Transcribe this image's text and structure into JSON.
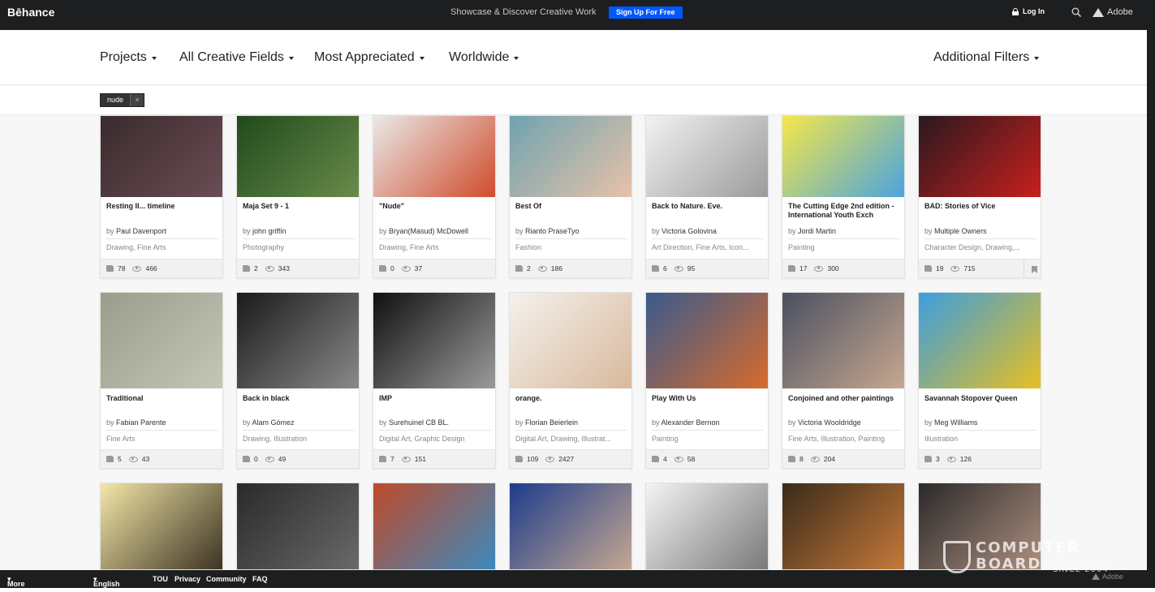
{
  "topbar": {
    "logo": "Bēhance",
    "tagline": "Showcase & Discover Creative Work",
    "signup": "Sign Up For Free",
    "login": "Log In",
    "adobe": "Adobe"
  },
  "filters": {
    "projects": "Projects",
    "fields": "All Creative Fields",
    "sort": "Most Appreciated",
    "location": "Worldwide",
    "additional": "Additional Filters"
  },
  "tag": {
    "label": "nude",
    "remove": "×"
  },
  "cards": [
    {
      "title": "Resting II... timeline",
      "owner": "Paul Davenport",
      "fields": "Drawing, Fine Arts",
      "likes": "78",
      "views": "466"
    },
    {
      "title": "Maja Set 9 - 1",
      "owner": "john griffin",
      "fields": "Photography",
      "likes": "2",
      "views": "343"
    },
    {
      "title": "\"Nude\"",
      "owner": "Bryan(Masud) McDowell",
      "fields": "Drawing, Fine Arts",
      "likes": "0",
      "views": "37"
    },
    {
      "title": "Best Of",
      "owner": "Rianto PraseTyo",
      "fields": "Fashion",
      "likes": "2",
      "views": "186"
    },
    {
      "title": "Back to Nature. Eve.",
      "owner": "Victoria Golovina",
      "fields": "Art Direction, Fine Arts, Icon...",
      "likes": "6",
      "views": "95"
    },
    {
      "title": "The Cutting Edge 2nd edition - International Youth Exch",
      "owner": "Jordi Martin",
      "fields": "Painting",
      "likes": "17",
      "views": "300"
    },
    {
      "title": "BAD: Stories of Vice",
      "owner": "Multiple Owners",
      "fields": "Character Design, Drawing,...",
      "likes": "19",
      "views": "715"
    },
    {
      "title": "Traditional",
      "owner": "Fabian Parente",
      "fields": "Fine Arts",
      "likes": "5",
      "views": "43"
    },
    {
      "title": "Back in black",
      "owner": "Alam Gómez",
      "fields": "Drawing, Illustration",
      "likes": "0",
      "views": "49"
    },
    {
      "title": "IMP",
      "owner": "Surehuinel CB BL.",
      "fields": "Digital Art, Graphic Design",
      "likes": "7",
      "views": "151"
    },
    {
      "title": "orange.",
      "owner": "Florian Beierlein",
      "fields": "Digital Art, Drawing, Illustrat...",
      "likes": "109",
      "views": "2427"
    },
    {
      "title": "Play With Us",
      "owner": "Alexander Bernon",
      "fields": "Painting",
      "likes": "4",
      "views": "58"
    },
    {
      "title": "Conjoined and other paintings",
      "owner": "Victoria Wooldridge",
      "fields": "Fine Arts, Illustration, Painting",
      "likes": "8",
      "views": "204"
    },
    {
      "title": "Savannah Stopover Queen",
      "owner": "Meg Williams",
      "fields": "Illustration",
      "likes": "3",
      "views": "126"
    }
  ],
  "card_by": "by",
  "footer": {
    "more": "More Behance",
    "lang": "English",
    "tou": "TOU",
    "privacy": "Privacy",
    "community": "Community",
    "faq": "FAQ",
    "adobe": "Adobe"
  },
  "watermark": {
    "line1": "COMPUTER",
    "line2": "BOARD",
    "since": "SINCE 2004"
  },
  "colors": {
    "accent": "#0057ff",
    "topbar": "#1d1e20"
  }
}
